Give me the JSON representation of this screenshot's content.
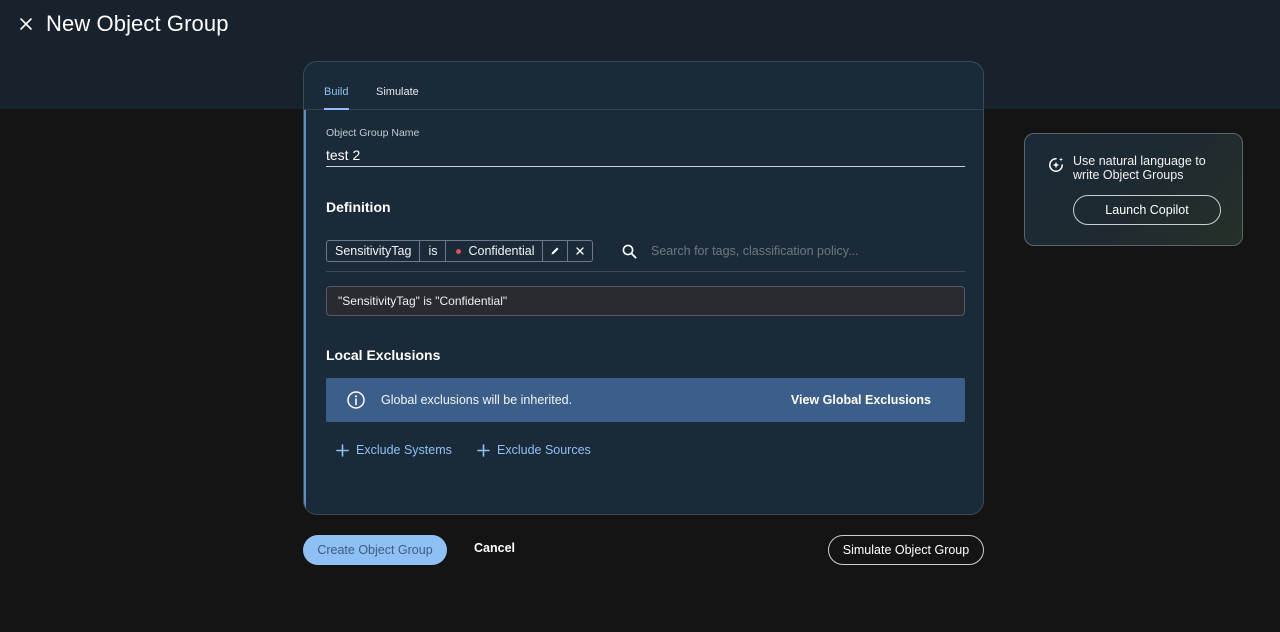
{
  "header": {
    "title": "New Object Group"
  },
  "tabs": [
    {
      "label": "Build",
      "active": true
    },
    {
      "label": "Simulate",
      "active": false
    }
  ],
  "form": {
    "name_label": "Object Group Name",
    "name_value": "test 2",
    "definition_title": "Definition",
    "chip": {
      "key": "SensitivityTag",
      "operator": "is",
      "value": "Confidential",
      "value_dot_color": "#e0505a"
    },
    "search_placeholder": "Search for tags, classification policy...",
    "expression": "\"SensitivityTag\" is \"Confidential\"",
    "exclusions_title": "Local Exclusions",
    "info_text": "Global exclusions will be inherited.",
    "view_global_label": "View Global Exclusions",
    "exclude_systems_label": "Exclude Systems",
    "exclude_sources_label": "Exclude Sources"
  },
  "footer": {
    "create_label": "Create Object Group",
    "cancel_label": "Cancel",
    "simulate_label": "Simulate Object Group"
  },
  "copilot": {
    "text": "Use natural language to write Object Groups",
    "button_label": "Launch Copilot"
  },
  "colors": {
    "accent": "#8ec0f5",
    "card_bg": "#1b2a38",
    "banner_bg": "#3b5f8a",
    "page_bg": "#141414"
  }
}
